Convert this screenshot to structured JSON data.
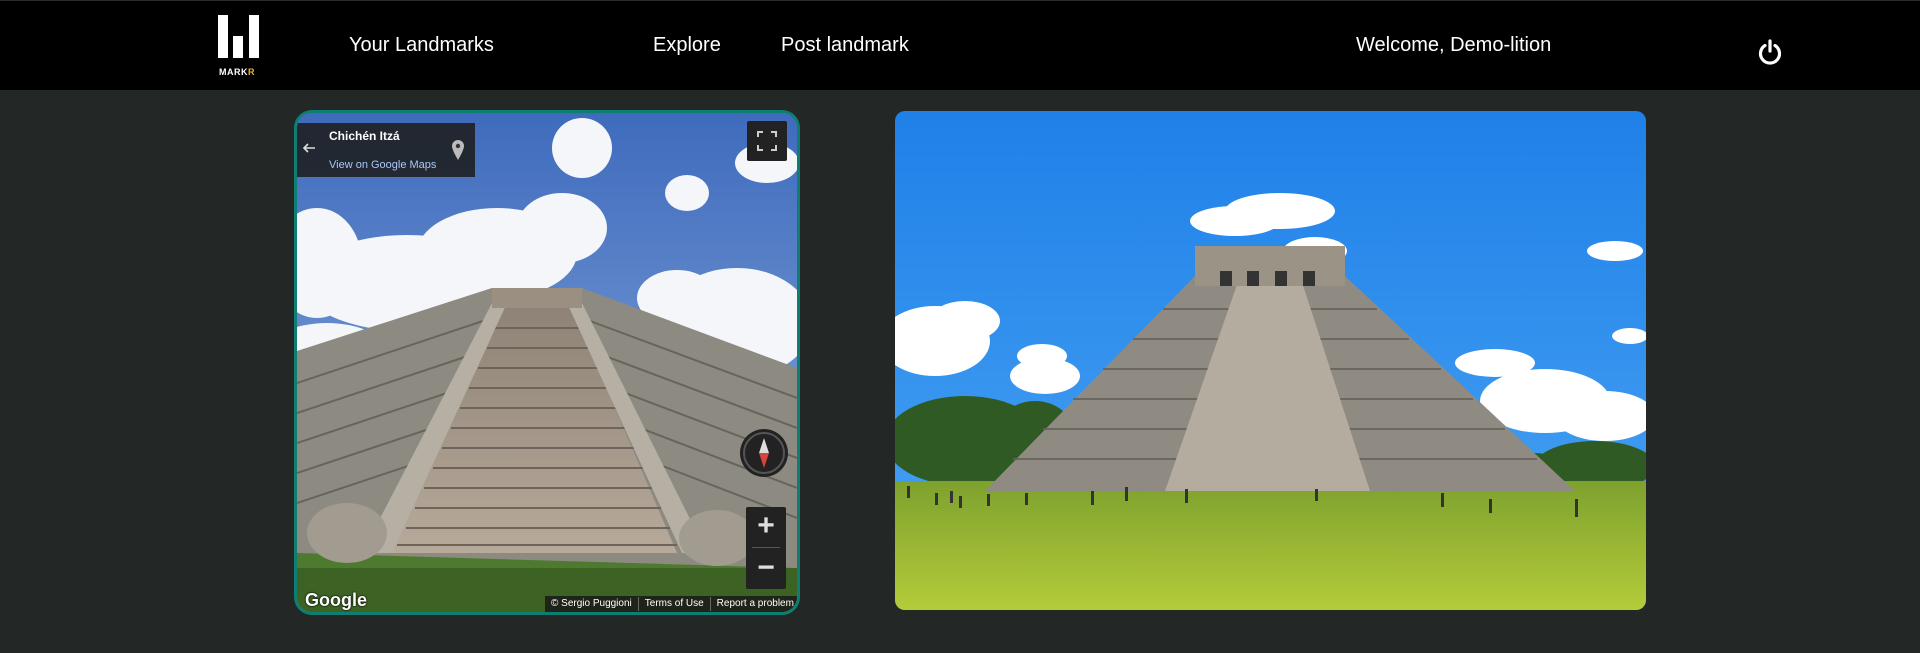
{
  "brand": {
    "logo_text_white": "MARK",
    "logo_text_accent": "R",
    "accent_color": "#f0b429"
  },
  "nav": {
    "your_landmarks": "Your Landmarks",
    "explore": "Explore",
    "post_landmark": "Post landmark",
    "welcome": "Welcome, Demo-lition",
    "power_icon": "power-icon"
  },
  "streetview": {
    "place_title": "Chichén Itzá",
    "view_on_maps": "View on Google Maps",
    "zoom_in": "+",
    "zoom_out": "−",
    "google_mark": "Google",
    "copyright": "© Sergio Puggioni",
    "terms": "Terms of Use",
    "report": "Report a problem",
    "frame_color": "#0f7e72"
  },
  "photo": {
    "subject": "El Castillo pyramid"
  }
}
